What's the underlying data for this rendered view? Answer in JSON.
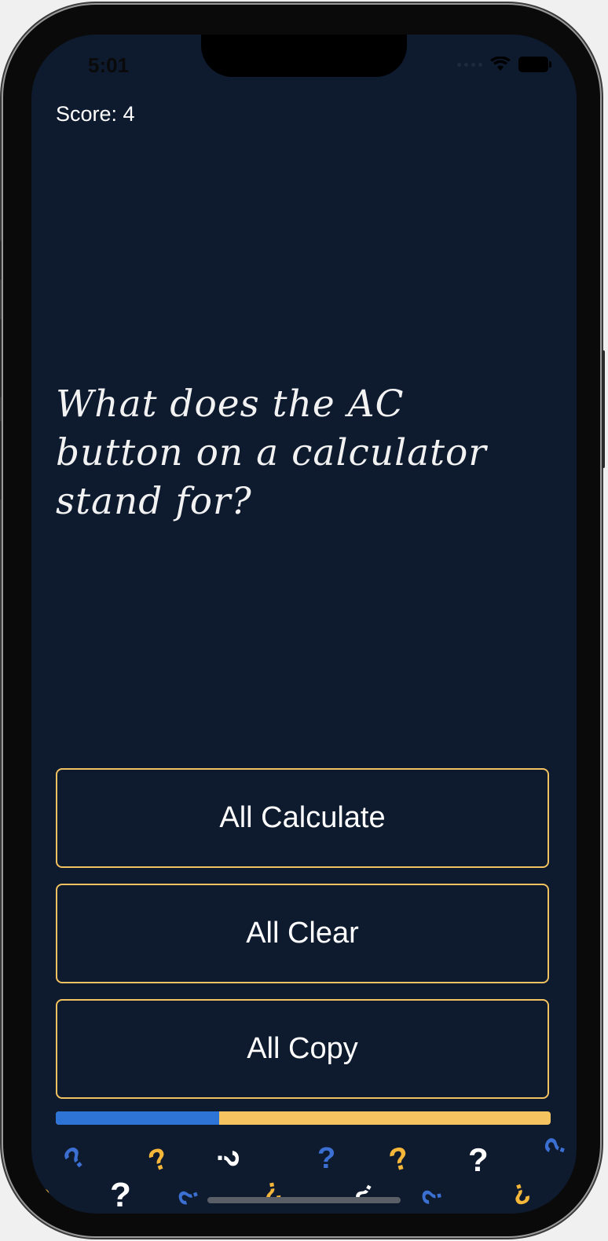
{
  "status_bar": {
    "time": "5:01"
  },
  "score": "Score: 4",
  "question": "What does the AC button on a calculator stand for?",
  "answers": [
    {
      "label": "All Calculate"
    },
    {
      "label": "All Clear"
    },
    {
      "label": "All Copy"
    }
  ],
  "progress": {
    "fraction": 0.33
  },
  "colors": {
    "background": "#0e1a2e",
    "button_border": "#f2c260",
    "progress_fill": "#2e74d6",
    "progress_track": "#f5c460",
    "qmark_blue": "#3b6fd1",
    "qmark_yellow": "#f5b73a",
    "qmark_white": "#ffffff"
  },
  "decor": {
    "qmarks": [
      {
        "glyph": "?",
        "color": "blue"
      },
      {
        "glyph": "?",
        "color": "yellow"
      },
      {
        "glyph": "?",
        "color": "white"
      },
      {
        "glyph": "?",
        "color": "blue"
      },
      {
        "glyph": "?",
        "color": "yellow"
      },
      {
        "glyph": "?",
        "color": "white"
      },
      {
        "glyph": "?",
        "color": "blue"
      },
      {
        "glyph": "?",
        "color": "yellow"
      },
      {
        "glyph": "?",
        "color": "white"
      },
      {
        "glyph": "?",
        "color": "blue"
      },
      {
        "glyph": "?",
        "color": "yellow"
      },
      {
        "glyph": "?",
        "color": "white"
      },
      {
        "glyph": "?",
        "color": "blue"
      },
      {
        "glyph": "?",
        "color": "yellow"
      }
    ]
  }
}
